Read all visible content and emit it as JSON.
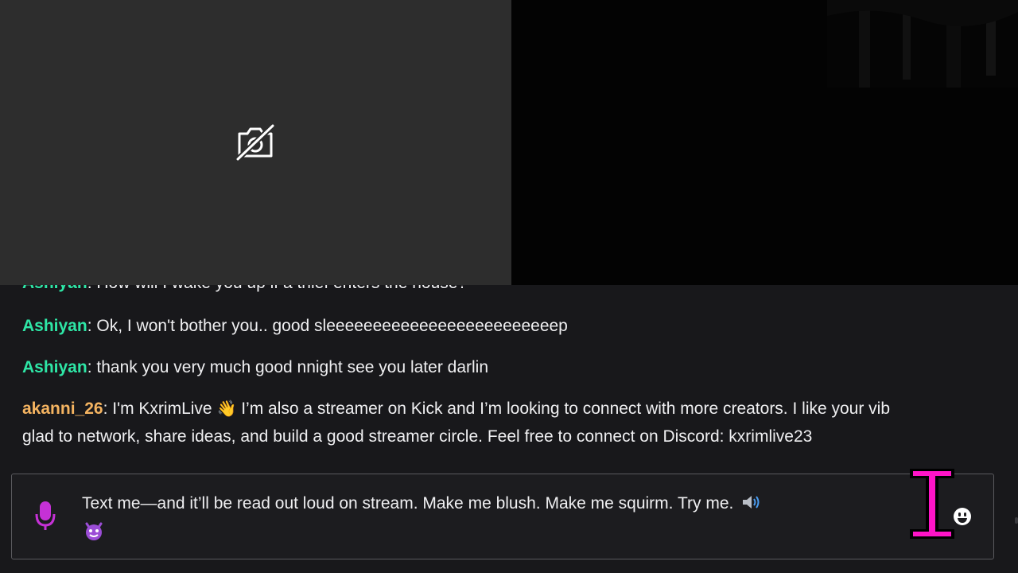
{
  "chat": {
    "cut_message": {
      "user": "Ashiyan",
      "text": "How will I wake you up if a thief enters the house?"
    },
    "messages": [
      {
        "user": "Ashiyan",
        "text": "Ok, I won't bother you.. good sleeeeeeeeeeeeeeeeeeeeeeeeep"
      },
      {
        "user": "Ashiyan",
        "text": "thank you very much good nnight see you later darlin"
      },
      {
        "user": "akanni_26",
        "text_part1": "I'm KxrimLive ",
        "emoji": "👋",
        "text_part2": " I’m also a streamer on Kick and I’m looking to connect with more creators. I like your vib",
        "text_line2": "glad to network, share ideas, and build a good streamer circle. Feel free to connect on Discord: kxrimlive23"
      }
    ]
  },
  "input": {
    "value": "Text me—and it’ll be read out loud on stream. Make me blush. Make me squirm. Try me.",
    "speaker_icon": "speaker-icon",
    "devil_icon": "smiling-devil-icon",
    "mic_icon": "microphone-icon",
    "emote_icon": "emote-icon"
  },
  "colors": {
    "user_green": "#2ee6a6",
    "user_orange": "#f5b461",
    "mic": "#c531d6",
    "cursor": "#ff14c8"
  }
}
